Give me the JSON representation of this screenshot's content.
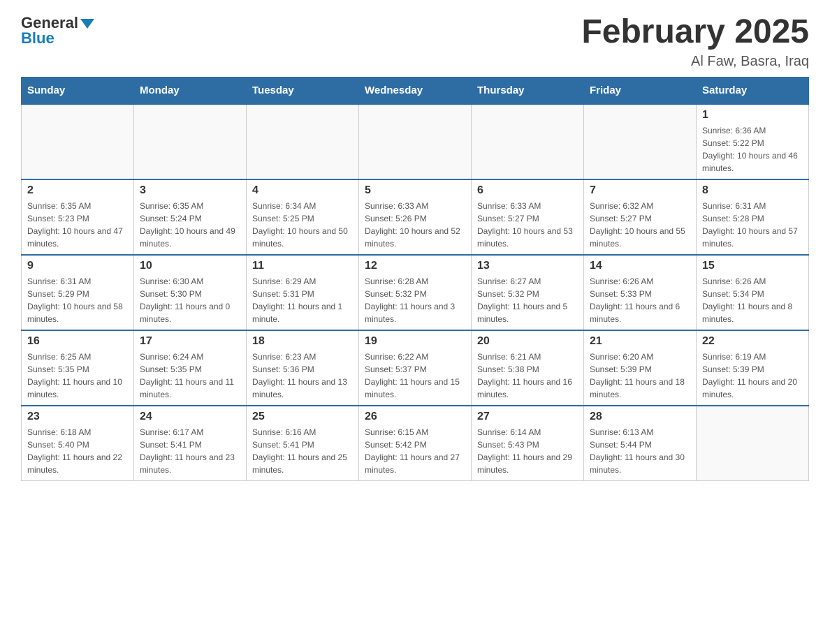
{
  "header": {
    "logo": {
      "general": "General",
      "blue": "Blue"
    },
    "title": "February 2025",
    "location": "Al Faw, Basra, Iraq"
  },
  "days_of_week": [
    "Sunday",
    "Monday",
    "Tuesday",
    "Wednesday",
    "Thursday",
    "Friday",
    "Saturday"
  ],
  "weeks": [
    [
      {
        "day": "",
        "sunrise": "",
        "sunset": "",
        "daylight": ""
      },
      {
        "day": "",
        "sunrise": "",
        "sunset": "",
        "daylight": ""
      },
      {
        "day": "",
        "sunrise": "",
        "sunset": "",
        "daylight": ""
      },
      {
        "day": "",
        "sunrise": "",
        "sunset": "",
        "daylight": ""
      },
      {
        "day": "",
        "sunrise": "",
        "sunset": "",
        "daylight": ""
      },
      {
        "day": "",
        "sunrise": "",
        "sunset": "",
        "daylight": ""
      },
      {
        "day": "1",
        "sunrise": "Sunrise: 6:36 AM",
        "sunset": "Sunset: 5:22 PM",
        "daylight": "Daylight: 10 hours and 46 minutes."
      }
    ],
    [
      {
        "day": "2",
        "sunrise": "Sunrise: 6:35 AM",
        "sunset": "Sunset: 5:23 PM",
        "daylight": "Daylight: 10 hours and 47 minutes."
      },
      {
        "day": "3",
        "sunrise": "Sunrise: 6:35 AM",
        "sunset": "Sunset: 5:24 PM",
        "daylight": "Daylight: 10 hours and 49 minutes."
      },
      {
        "day": "4",
        "sunrise": "Sunrise: 6:34 AM",
        "sunset": "Sunset: 5:25 PM",
        "daylight": "Daylight: 10 hours and 50 minutes."
      },
      {
        "day": "5",
        "sunrise": "Sunrise: 6:33 AM",
        "sunset": "Sunset: 5:26 PM",
        "daylight": "Daylight: 10 hours and 52 minutes."
      },
      {
        "day": "6",
        "sunrise": "Sunrise: 6:33 AM",
        "sunset": "Sunset: 5:27 PM",
        "daylight": "Daylight: 10 hours and 53 minutes."
      },
      {
        "day": "7",
        "sunrise": "Sunrise: 6:32 AM",
        "sunset": "Sunset: 5:27 PM",
        "daylight": "Daylight: 10 hours and 55 minutes."
      },
      {
        "day": "8",
        "sunrise": "Sunrise: 6:31 AM",
        "sunset": "Sunset: 5:28 PM",
        "daylight": "Daylight: 10 hours and 57 minutes."
      }
    ],
    [
      {
        "day": "9",
        "sunrise": "Sunrise: 6:31 AM",
        "sunset": "Sunset: 5:29 PM",
        "daylight": "Daylight: 10 hours and 58 minutes."
      },
      {
        "day": "10",
        "sunrise": "Sunrise: 6:30 AM",
        "sunset": "Sunset: 5:30 PM",
        "daylight": "Daylight: 11 hours and 0 minutes."
      },
      {
        "day": "11",
        "sunrise": "Sunrise: 6:29 AM",
        "sunset": "Sunset: 5:31 PM",
        "daylight": "Daylight: 11 hours and 1 minute."
      },
      {
        "day": "12",
        "sunrise": "Sunrise: 6:28 AM",
        "sunset": "Sunset: 5:32 PM",
        "daylight": "Daylight: 11 hours and 3 minutes."
      },
      {
        "day": "13",
        "sunrise": "Sunrise: 6:27 AM",
        "sunset": "Sunset: 5:32 PM",
        "daylight": "Daylight: 11 hours and 5 minutes."
      },
      {
        "day": "14",
        "sunrise": "Sunrise: 6:26 AM",
        "sunset": "Sunset: 5:33 PM",
        "daylight": "Daylight: 11 hours and 6 minutes."
      },
      {
        "day": "15",
        "sunrise": "Sunrise: 6:26 AM",
        "sunset": "Sunset: 5:34 PM",
        "daylight": "Daylight: 11 hours and 8 minutes."
      }
    ],
    [
      {
        "day": "16",
        "sunrise": "Sunrise: 6:25 AM",
        "sunset": "Sunset: 5:35 PM",
        "daylight": "Daylight: 11 hours and 10 minutes."
      },
      {
        "day": "17",
        "sunrise": "Sunrise: 6:24 AM",
        "sunset": "Sunset: 5:35 PM",
        "daylight": "Daylight: 11 hours and 11 minutes."
      },
      {
        "day": "18",
        "sunrise": "Sunrise: 6:23 AM",
        "sunset": "Sunset: 5:36 PM",
        "daylight": "Daylight: 11 hours and 13 minutes."
      },
      {
        "day": "19",
        "sunrise": "Sunrise: 6:22 AM",
        "sunset": "Sunset: 5:37 PM",
        "daylight": "Daylight: 11 hours and 15 minutes."
      },
      {
        "day": "20",
        "sunrise": "Sunrise: 6:21 AM",
        "sunset": "Sunset: 5:38 PM",
        "daylight": "Daylight: 11 hours and 16 minutes."
      },
      {
        "day": "21",
        "sunrise": "Sunrise: 6:20 AM",
        "sunset": "Sunset: 5:39 PM",
        "daylight": "Daylight: 11 hours and 18 minutes."
      },
      {
        "day": "22",
        "sunrise": "Sunrise: 6:19 AM",
        "sunset": "Sunset: 5:39 PM",
        "daylight": "Daylight: 11 hours and 20 minutes."
      }
    ],
    [
      {
        "day": "23",
        "sunrise": "Sunrise: 6:18 AM",
        "sunset": "Sunset: 5:40 PM",
        "daylight": "Daylight: 11 hours and 22 minutes."
      },
      {
        "day": "24",
        "sunrise": "Sunrise: 6:17 AM",
        "sunset": "Sunset: 5:41 PM",
        "daylight": "Daylight: 11 hours and 23 minutes."
      },
      {
        "day": "25",
        "sunrise": "Sunrise: 6:16 AM",
        "sunset": "Sunset: 5:41 PM",
        "daylight": "Daylight: 11 hours and 25 minutes."
      },
      {
        "day": "26",
        "sunrise": "Sunrise: 6:15 AM",
        "sunset": "Sunset: 5:42 PM",
        "daylight": "Daylight: 11 hours and 27 minutes."
      },
      {
        "day": "27",
        "sunrise": "Sunrise: 6:14 AM",
        "sunset": "Sunset: 5:43 PM",
        "daylight": "Daylight: 11 hours and 29 minutes."
      },
      {
        "day": "28",
        "sunrise": "Sunrise: 6:13 AM",
        "sunset": "Sunset: 5:44 PM",
        "daylight": "Daylight: 11 hours and 30 minutes."
      },
      {
        "day": "",
        "sunrise": "",
        "sunset": "",
        "daylight": ""
      }
    ]
  ]
}
